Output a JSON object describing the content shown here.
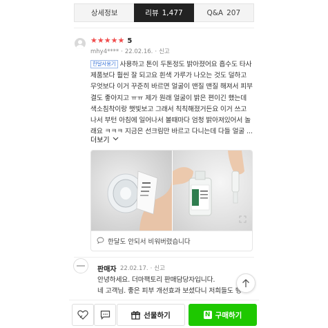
{
  "tabs": [
    {
      "label": "상세정보",
      "count": "",
      "active": false
    },
    {
      "label": "리뷰",
      "count": "1,477",
      "active": true
    },
    {
      "label": "Q&A",
      "count": "207",
      "active": false
    }
  ],
  "review": {
    "stars": [
      "★",
      "★",
      "★",
      "★",
      "★"
    ],
    "score": "5",
    "author": "mhy4****",
    "date": "22.02.16.",
    "report": "신고",
    "badge": "한달사용기",
    "lines": [
      "사용하고 톤이 두톤정도 밝아졌어요 흡수도 타사",
      "제품보다 훨씬 잘 되고요 흰색 가루가 나오는 것도 덜하고",
      "무엇보다 이거 꾸준히 바르면 얼굴이 맨질 맨질 해져서 피부",
      "결도 좋아지고 ㅠㅠ 제가 원래 얼굴이 밝은 편이긴 했는데",
      "색소침착이랑 햇빛보고 그래서 칙칙해졌거든요 이거 쓰고",
      "나서 부턴 아침에 일어나서 볼때마다 엄청 밝아져있어서 놀",
      "래요 ㅋㅋㅋ 지금은 선크림만 바르고 다니는데 다들 얼굴 ..."
    ],
    "more": "더보기",
    "photo_footer": "한달도 안되서 비워버렸습니다"
  },
  "seller": {
    "name": "판매자",
    "date": "22.02.17.",
    "report": "신고",
    "lines": [
      "안녕하세요. 더마팩토리 판매담당자입니다.",
      "네 고객님. 좋은 피부 개선효과 보셨다니 저희들도 행"
    ]
  },
  "bottom": {
    "gift_label": "선물하기",
    "buy_label": "구매하기",
    "n_logo": "N"
  },
  "colors": {
    "star": "#f04b4b",
    "buy_button": "#1ec800",
    "badge": "#3a74d8"
  }
}
